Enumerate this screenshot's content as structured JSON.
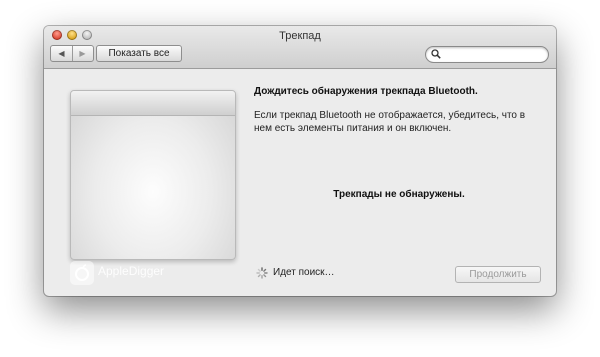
{
  "window": {
    "title": "Трекпад"
  },
  "toolbar": {
    "back_icon": "left-triangle-icon",
    "forward_icon": "right-triangle-icon",
    "show_all_label": "Показать все",
    "search": {
      "value": "",
      "placeholder": "",
      "icon": "search-icon"
    }
  },
  "content": {
    "heading": "Дождитесь обнаружения трекпада Bluetooth.",
    "description": "Если трекпад Bluetooth не отображается, убедитесь, что в нем есть элементы питания и он включен.",
    "status": "Трекпады не обнаружены.",
    "searching_label": "Идет поиск…",
    "continue_label": "Продолжить"
  },
  "watermark": {
    "text": "AppleDigger"
  },
  "colors": {
    "window_bg": "#ececec",
    "close": "#d9402c",
    "minimize": "#d9a21a",
    "zoom": "#b9b9b9"
  }
}
